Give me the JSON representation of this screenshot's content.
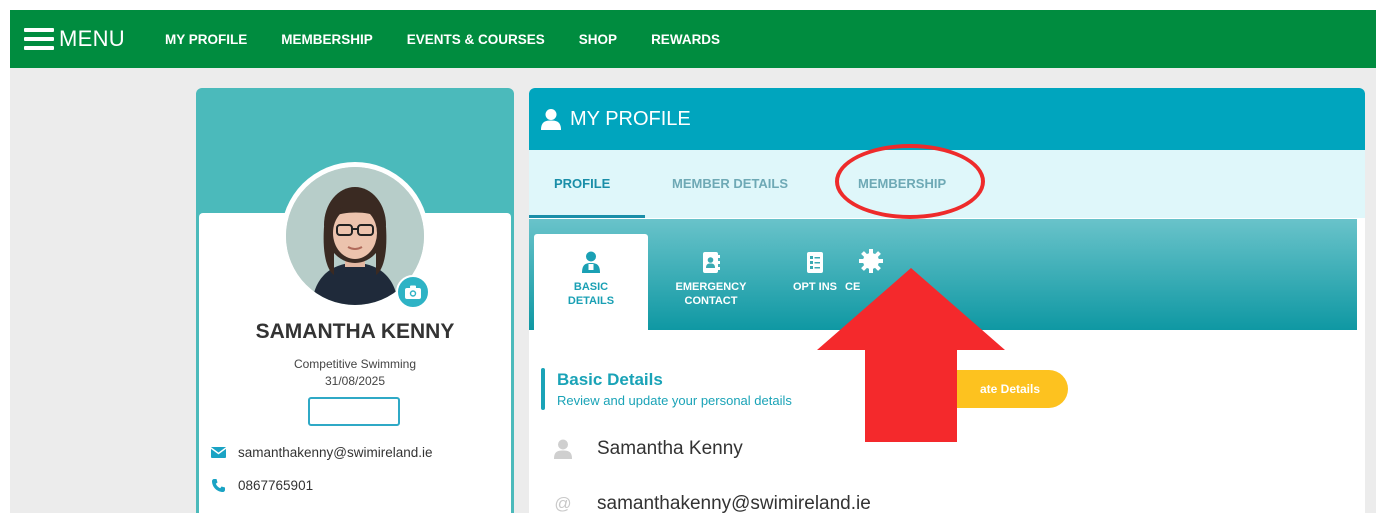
{
  "topnav": {
    "menu_label": "MENU",
    "items": [
      "MY PROFILE",
      "MEMBERSHIP",
      "EVENTS & COURSES",
      "SHOP",
      "REWARDS"
    ]
  },
  "profile_card": {
    "name": "SAMANTHA KENNY",
    "category": "Competitive Swimming",
    "date": "31/08/2025",
    "email": "samanthakenny@swimireland.ie",
    "phone": "0867765901"
  },
  "main_panel": {
    "title": "MY PROFILE",
    "tabs": [
      "PROFILE",
      "MEMBER DETAILS",
      "MEMBERSHIP"
    ],
    "subtabs": {
      "basic_details": "BASIC DETAILS",
      "emergency_contact": "EMERGENCY CONTACT",
      "opt_ins": "OPT INS",
      "partial": "CE"
    },
    "section": {
      "title": "Basic Details",
      "subtitle": "Review and update your personal details",
      "update_button": "ate Details"
    },
    "details": {
      "full_name": "Samantha Kenny",
      "email": "samanthakenny@swimireland.ie"
    }
  },
  "colors": {
    "nav_green": "#008c3f",
    "teal_header": "#00a5be",
    "card_teal": "#4bbabb",
    "accent_yellow": "#fdc21f",
    "annotation_red": "#ee2b2b"
  }
}
